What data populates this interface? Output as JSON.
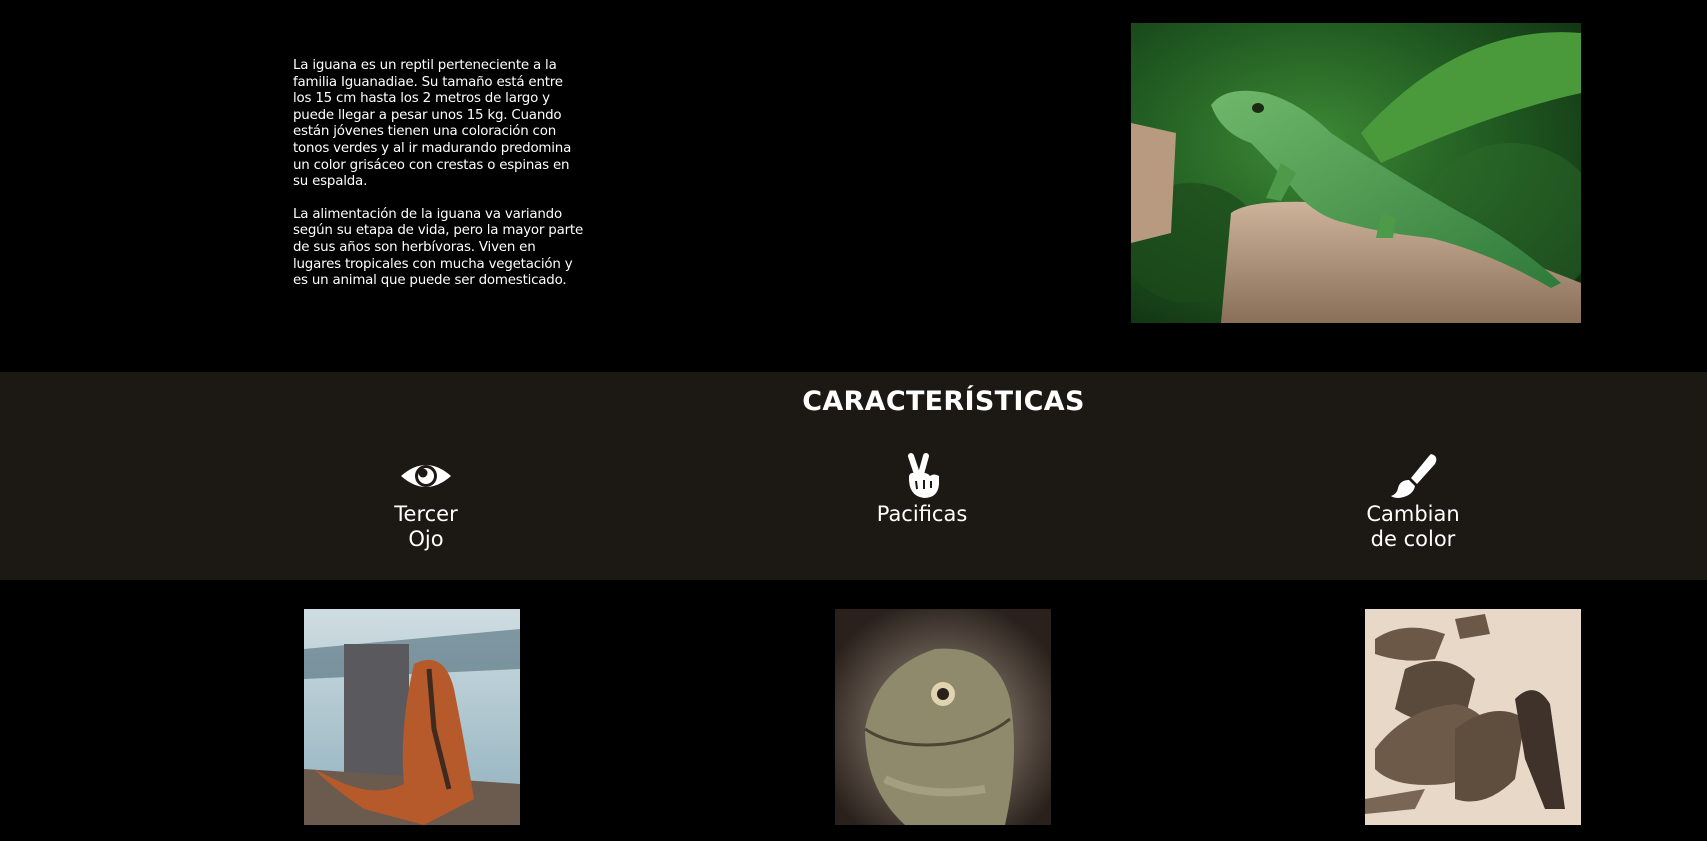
{
  "intro": {
    "paragraph_1": "La iguana es un reptil perteneciente a la familia Iguanadiae. Su tamaño está entre los 15 cm hasta los 2 metros de largo y puede llegar a pesar unos 15 kg. Cuando están jóvenes tienen una coloración con tonos verdes y al ir madurando predomina un color grisáceo con crestas o espinas en su espalda.",
    "paragraph_2": "La alimentación de la iguana va variando según su etapa de vida, pero la mayor parte de sus años son herbívoras. Viven en lugares tropicales con mucha vegetación y es un animal que puede ser domesticado.",
    "hero_image": "green-iguana-on-tree-stump-photo"
  },
  "features": {
    "title": "CARACTERÍSTICAS",
    "items": [
      {
        "icon": "eye-icon",
        "label_line_1": "Tercer",
        "label_line_2": "Ojo"
      },
      {
        "icon": "peace-hand-icon",
        "label_line_1": "Pacificas",
        "label_line_2": ""
      },
      {
        "icon": "paintbrush-icon",
        "label_line_1": "Cambian",
        "label_line_2": "de color"
      }
    ]
  },
  "gallery": [
    {
      "image": "orange-iguana-by-water-photo"
    },
    {
      "image": "iguana-head-closeup-photo"
    },
    {
      "image": "group-of-iguanas-on-sand-photo"
    }
  ],
  "colors": {
    "page_background": "#000000",
    "band_background": "#1c1813",
    "text": "#ffffff"
  }
}
